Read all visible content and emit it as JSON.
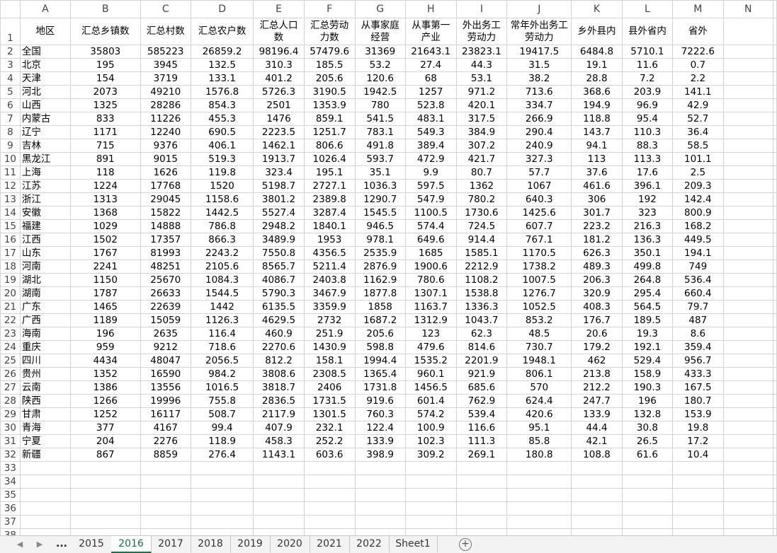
{
  "columns": [
    "A",
    "B",
    "C",
    "D",
    "E",
    "F",
    "G",
    "H",
    "I",
    "J",
    "K",
    "L",
    "M",
    "N"
  ],
  "headers": [
    "地区",
    "汇总乡镇数",
    "汇总村数",
    "汇总农户数",
    "汇总人口数",
    "汇总劳动力数",
    "从事家庭经营",
    "从事第一产业",
    "外出务工劳动力",
    "常年外出务工劳动力",
    "乡外县内",
    "县外省内",
    "省外"
  ],
  "rows": [
    [
      "全国",
      "35803",
      "585223",
      "26859.2",
      "98196.4",
      "57479.6",
      "31369",
      "21643.1",
      "23823.1",
      "19417.5",
      "6484.8",
      "5710.1",
      "7222.6"
    ],
    [
      "北京",
      "195",
      "3945",
      "132.5",
      "310.3",
      "185.5",
      "53.2",
      "27.4",
      "44.3",
      "31.5",
      "19.1",
      "11.6",
      "0.7"
    ],
    [
      "天津",
      "154",
      "3719",
      "133.1",
      "401.2",
      "205.6",
      "120.6",
      "68",
      "53.1",
      "38.2",
      "28.8",
      "7.2",
      "2.2"
    ],
    [
      "河北",
      "2073",
      "49210",
      "1576.8",
      "5726.3",
      "3190.5",
      "1942.5",
      "1257",
      "971.2",
      "713.6",
      "368.6",
      "203.9",
      "141.1"
    ],
    [
      "山西",
      "1325",
      "28286",
      "854.3",
      "2501",
      "1353.9",
      "780",
      "523.8",
      "420.1",
      "334.7",
      "194.9",
      "96.9",
      "42.9"
    ],
    [
      "内蒙古",
      "833",
      "11226",
      "455.3",
      "1476",
      "859.1",
      "541.5",
      "483.1",
      "317.5",
      "266.9",
      "118.8",
      "95.4",
      "52.7"
    ],
    [
      "辽宁",
      "1171",
      "12240",
      "690.5",
      "2223.5",
      "1251.7",
      "783.1",
      "549.3",
      "384.9",
      "290.4",
      "143.7",
      "110.3",
      "36.4"
    ],
    [
      "吉林",
      "715",
      "9376",
      "406.1",
      "1462.1",
      "806.6",
      "491.8",
      "389.4",
      "307.2",
      "240.9",
      "94.1",
      "88.3",
      "58.5"
    ],
    [
      "黑龙江",
      "891",
      "9015",
      "519.3",
      "1913.7",
      "1026.4",
      "593.7",
      "472.9",
      "421.7",
      "327.3",
      "113",
      "113.3",
      "101.1"
    ],
    [
      "上海",
      "118",
      "1626",
      "119.8",
      "323.4",
      "195.1",
      "35.1",
      "9.9",
      "80.7",
      "57.7",
      "37.6",
      "17.6",
      "2.5"
    ],
    [
      "江苏",
      "1224",
      "17768",
      "1520",
      "5198.7",
      "2727.1",
      "1036.3",
      "597.5",
      "1362",
      "1067",
      "461.6",
      "396.1",
      "209.3"
    ],
    [
      "浙江",
      "1313",
      "29045",
      "1158.6",
      "3801.2",
      "2389.8",
      "1290.7",
      "547.9",
      "780.2",
      "640.3",
      "306",
      "192",
      "142.4"
    ],
    [
      "安徽",
      "1368",
      "15822",
      "1442.5",
      "5527.4",
      "3287.4",
      "1545.5",
      "1100.5",
      "1730.6",
      "1425.6",
      "301.7",
      "323",
      "800.9"
    ],
    [
      "福建",
      "1029",
      "14888",
      "786.8",
      "2948.2",
      "1840.1",
      "946.5",
      "574.4",
      "724.5",
      "607.7",
      "223.2",
      "216.3",
      "168.2"
    ],
    [
      "江西",
      "1502",
      "17357",
      "866.3",
      "3489.9",
      "1953",
      "978.1",
      "649.6",
      "914.4",
      "767.1",
      "181.2",
      "136.3",
      "449.5"
    ],
    [
      "山东",
      "1767",
      "81993",
      "2243.2",
      "7550.8",
      "4356.5",
      "2535.9",
      "1685",
      "1585.1",
      "1170.5",
      "626.3",
      "350.1",
      "194.1"
    ],
    [
      "河南",
      "2241",
      "48251",
      "2105.6",
      "8565.7",
      "5211.4",
      "2876.9",
      "1900.6",
      "2212.9",
      "1738.2",
      "489.3",
      "499.8",
      "749"
    ],
    [
      "湖北",
      "1150",
      "25670",
      "1084.3",
      "4086.7",
      "2403.8",
      "1162.9",
      "780.6",
      "1108.2",
      "1007.5",
      "206.3",
      "264.8",
      "536.4"
    ],
    [
      "湖南",
      "1787",
      "26633",
      "1544.5",
      "5790.3",
      "3467.9",
      "1877.8",
      "1307.1",
      "1538.8",
      "1276.7",
      "320.9",
      "295.4",
      "660.4"
    ],
    [
      "广东",
      "1465",
      "22639",
      "1442",
      "6135.5",
      "3359.9",
      "1858",
      "1163.7",
      "1336.3",
      "1052.5",
      "408.3",
      "564.5",
      "79.7"
    ],
    [
      "广西",
      "1189",
      "15059",
      "1126.3",
      "4629.5",
      "2732",
      "1687.2",
      "1312.9",
      "1043.7",
      "853.2",
      "176.7",
      "189.5",
      "487"
    ],
    [
      "海南",
      "196",
      "2635",
      "116.4",
      "460.9",
      "251.9",
      "205.6",
      "123",
      "62.3",
      "48.5",
      "20.6",
      "19.3",
      "8.6"
    ],
    [
      "重庆",
      "959",
      "9212",
      "718.6",
      "2270.6",
      "1430.9",
      "598.8",
      "479.6",
      "814.6",
      "730.7",
      "179.2",
      "192.1",
      "359.4"
    ],
    [
      "四川",
      "4434",
      "48047",
      "2056.5",
      "812.2",
      "158.1",
      "1994.4",
      "1535.2",
      "2201.9",
      "1948.1",
      "462",
      "529.4",
      "956.7"
    ],
    [
      "贵州",
      "1352",
      "16590",
      "984.2",
      "3808.6",
      "2308.5",
      "1365.4",
      "960.1",
      "921.9",
      "806.1",
      "213.8",
      "158.9",
      "433.3"
    ],
    [
      "云南",
      "1386",
      "13556",
      "1016.5",
      "3818.7",
      "2406",
      "1731.8",
      "1456.5",
      "685.6",
      "570",
      "212.2",
      "190.3",
      "167.5"
    ],
    [
      "陕西",
      "1266",
      "19996",
      "755.8",
      "2836.5",
      "1731.5",
      "919.6",
      "601.4",
      "762.9",
      "624.4",
      "247.7",
      "196",
      "180.7"
    ],
    [
      "甘肃",
      "1252",
      "16117",
      "508.7",
      "2117.9",
      "1301.5",
      "760.3",
      "574.2",
      "539.4",
      "420.6",
      "133.9",
      "132.8",
      "153.9"
    ],
    [
      "青海",
      "377",
      "4167",
      "99.4",
      "407.9",
      "232.1",
      "122.4",
      "100.9",
      "116.6",
      "95.1",
      "44.4",
      "30.8",
      "19.8"
    ],
    [
      "宁夏",
      "204",
      "2276",
      "118.9",
      "458.3",
      "252.2",
      "133.9",
      "102.3",
      "111.3",
      "85.8",
      "42.1",
      "26.5",
      "17.2"
    ],
    [
      "新疆",
      "867",
      "8859",
      "276.4",
      "1143.1",
      "603.6",
      "398.9",
      "309.2",
      "269.1",
      "180.8",
      "108.8",
      "61.6",
      "10.4"
    ]
  ],
  "empty_rows": [
    "33",
    "34",
    "35",
    "36",
    "37",
    "38"
  ],
  "tabs": {
    "ellipsis": "...",
    "sheets": [
      "2015",
      "2016",
      "2017",
      "2018",
      "2019",
      "2020",
      "2021",
      "2022",
      "Sheet1"
    ],
    "active": "2016",
    "add": "+"
  },
  "nav": {
    "prev": "◀",
    "next": "▶"
  }
}
